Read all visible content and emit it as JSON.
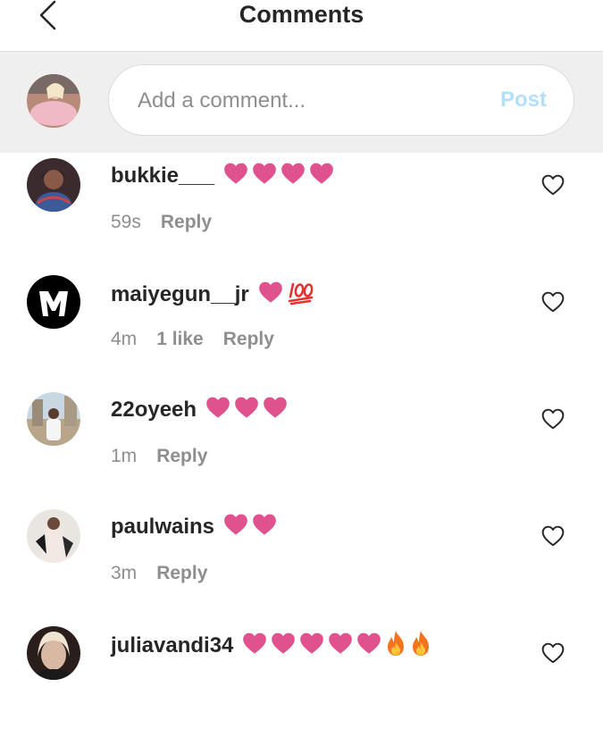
{
  "header": {
    "title": "Comments",
    "back_icon": "chevron-left-icon"
  },
  "composer": {
    "placeholder": "Add a comment...",
    "post_label": "Post"
  },
  "colors": {
    "heart": "#e0528e",
    "post_disabled": "#b2dffc",
    "muted": "#8e8e8e"
  },
  "comments": [
    {
      "username": "bukkie___",
      "emojis": [
        "heart",
        "heart",
        "heart",
        "heart"
      ],
      "time": "59s",
      "likes": "",
      "reply": "Reply"
    },
    {
      "username": "maiyegun__jr",
      "emojis": [
        "heart",
        "hundred"
      ],
      "time": "4m",
      "likes": "1 like",
      "reply": "Reply"
    },
    {
      "username": "22oyeeh",
      "emojis": [
        "heart",
        "heart",
        "heart"
      ],
      "time": "1m",
      "likes": "",
      "reply": "Reply"
    },
    {
      "username": "paulwains",
      "emojis": [
        "heart",
        "heart"
      ],
      "time": "3m",
      "likes": "",
      "reply": "Reply"
    },
    {
      "username": "juliavandi34",
      "emojis": [
        "heart",
        "heart",
        "heart",
        "heart",
        "heart",
        "fire",
        "fire"
      ],
      "time": "",
      "likes": "",
      "reply": ""
    }
  ]
}
